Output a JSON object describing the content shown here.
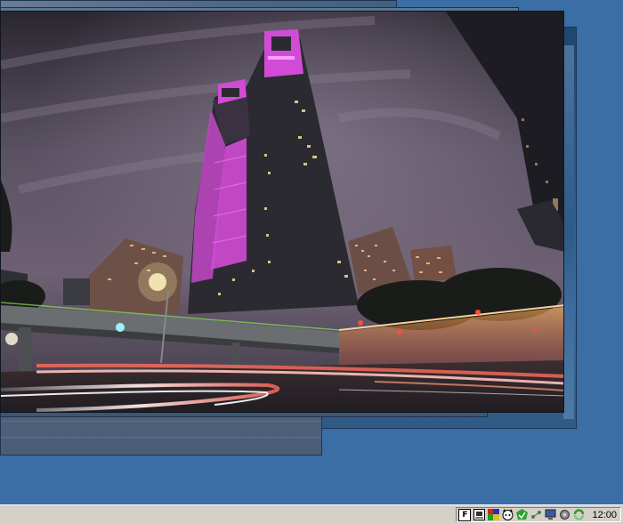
{
  "taskbar": {
    "clock": "12:00",
    "tray_icons": [
      "font-icon",
      "display-settings-icon",
      "color-palette-icon",
      "cat-mascot-icon",
      "green-shield-icon",
      "network-icon",
      "monitor-icon",
      "gear-icon",
      "green-cycle-icon"
    ],
    "tray_font_glyph": "F"
  },
  "colors": {
    "desktop": "#3a6ea5",
    "taskbar": "#d4d0c8",
    "tower_magenta": "#d24bd6"
  }
}
